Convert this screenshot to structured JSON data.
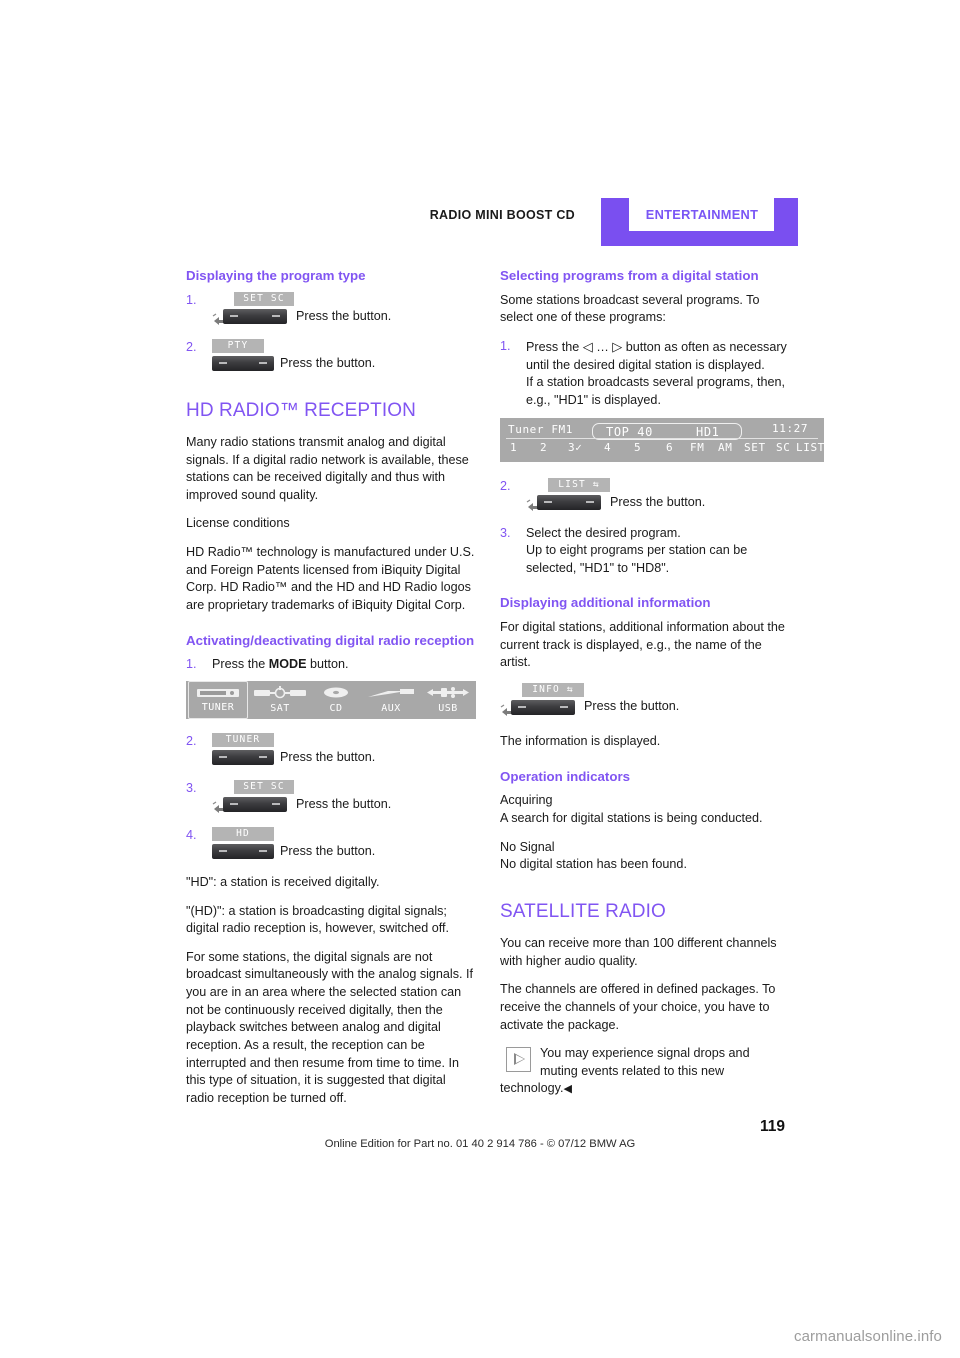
{
  "header": {
    "left_title": "RADIO MINI BOOST CD",
    "right_title": "ENTERTAINMENT"
  },
  "left_column": {
    "section_program_type": {
      "heading": "Displaying the program type",
      "steps": [
        {
          "num": "1.",
          "lcd_tag": "SET  SC",
          "press_label": "Press the button.",
          "has_hand": true
        },
        {
          "num": "2.",
          "lcd_tag": "PTY",
          "press_label": "Press the button.",
          "has_hand": false
        }
      ]
    },
    "hd_radio": {
      "title": "HD RADIO™ RECEPTION",
      "paragraphs": [
        "Many radio stations transmit analog and digital signals. If a digital radio network is available, these stations can be received digitally and thus with improved sound quality.",
        "License conditions",
        "HD Radio™ technology is manufactured under U.S. and Foreign Patents licensed from iBiquity Digital Corp. HD Radio™ and the HD and HD Radio logos are proprietary trademarks of iBiquity Digital Corp."
      ]
    },
    "activating": {
      "heading": "Activating/deactivating digital radio reception",
      "step1_num": "1.",
      "step1_pre": "Press the ",
      "step1_bold": "MODE",
      "step1_post": " button.",
      "modebar": [
        {
          "label": "TUNER",
          "icon": "tuner-icon",
          "selected": true
        },
        {
          "label": "SAT",
          "icon": "satellite-icon",
          "selected": false
        },
        {
          "label": "CD",
          "icon": "cd-disc-icon",
          "selected": false
        },
        {
          "label": "AUX",
          "icon": "aux-plug-icon",
          "selected": false
        },
        {
          "label": "USB",
          "icon": "usb-icon",
          "selected": false
        }
      ],
      "steps": [
        {
          "num": "2.",
          "lcd_tag": "TUNER",
          "press_label": "Press the button.",
          "has_hand": false
        },
        {
          "num": "3.",
          "lcd_tag": "SET  SC",
          "press_label": "Press the button.",
          "has_hand": true
        },
        {
          "num": "4.",
          "lcd_tag": "HD",
          "press_label": "Press the button.",
          "has_hand": false
        }
      ],
      "after_paragraphs": [
        "\"HD\": a station is received digitally.",
        "\"(HD)\": a station is broadcasting digital signals; digital radio reception is, however, switched off.",
        "For some stations, the digital signals are not broadcast simultaneously with the analog signals. If you are in an area where the selected station can not be continuously received digitally, then the playback switches between analog and digital reception. As a result, the reception can be interrupted and then resume from time to time. In this type of situation, it is suggested that digital radio reception be turned off."
      ]
    }
  },
  "right_column": {
    "selecting_programs": {
      "heading": "Selecting programs from a digital station",
      "intro": "Some stations broadcast several programs. To select one of these programs:",
      "step1": {
        "num": "1.",
        "text_a": "Press the ",
        "arrow_left": "◁",
        "ellipsis": " … ",
        "arrow_right": "▷",
        "text_b": " button as often as necessary until the desired digital station is displayed.",
        "text_c": "If a station broadcasts several programs, then, e.g., \"HD1\" is displayed."
      },
      "lcd_display": {
        "source": "Tuner FM1",
        "station": "TOP 40",
        "program": "HD1",
        "clock": "11:27",
        "presets": [
          "1",
          "2",
          "3✓",
          "4",
          "5",
          "6"
        ],
        "functions": [
          "FM",
          "AM",
          "SET",
          "SC",
          "LIST"
        ],
        "list_arrow": "⇆"
      },
      "step2": {
        "num": "2.",
        "lcd_tag": "LIST  ⇆",
        "press_label": "Press the button.",
        "has_hand": true
      },
      "step3": {
        "num": "3.",
        "line1": "Select the desired program.",
        "line2": "Up to eight programs per station can be selected, \"HD1\" to \"HD8\"."
      }
    },
    "additional_info": {
      "heading": "Displaying additional information",
      "paragraph": "For digital stations, additional information about the current track is displayed, e.g., the name of the artist.",
      "button": {
        "lcd_tag": "INFO  ⇆",
        "press_label": "Press the button.",
        "has_hand": true
      },
      "closing": "The information is displayed."
    },
    "operation_indicators": {
      "heading": "Operation indicators",
      "items": [
        {
          "term": "Acquiring",
          "desc": "A search for digital stations is being conducted."
        },
        {
          "term": "No Signal",
          "desc": "No digital station has been found."
        }
      ]
    },
    "satellite_radio": {
      "title": "SATELLITE RADIO",
      "paragraphs": [
        "You can receive more than 100 different channels with higher audio quality.",
        "The channels are offered in defined packages. To receive the channels of your choice, you have to activate the package."
      ],
      "note": {
        "text_indented": "You may experience signal drops and muting events related to this new",
        "text_continued": "technology.",
        "end_mark": "◀"
      }
    }
  },
  "footer": {
    "page_number": "119",
    "edition_line": "Online Edition for Part no. 01 40 2 914 786 - © 07/12 BMW AG",
    "watermark": "carmanualsonline.info"
  },
  "colors": {
    "accent_purple": "#8155f2",
    "header_bracket": "#7a4ff0",
    "lcd_gray": "#a9a9a9",
    "tag_gray": "#b4b4b4"
  }
}
